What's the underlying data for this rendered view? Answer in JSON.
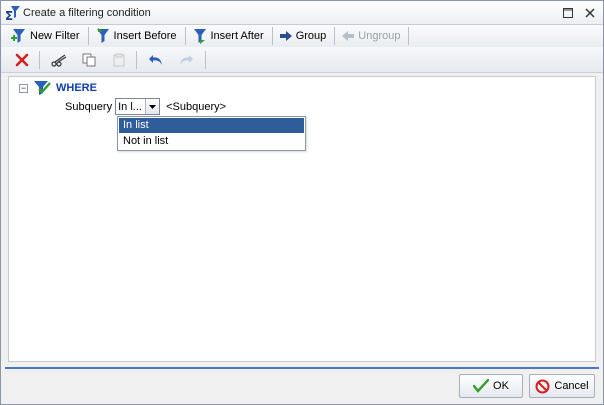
{
  "window": {
    "title": "Create a filtering condition"
  },
  "toolbar": {
    "new_filter": "New Filter",
    "insert_before": "Insert Before",
    "insert_after": "Insert After",
    "group": "Group",
    "ungroup": "Ungroup"
  },
  "edit_toolbar": {
    "icons": [
      "delete-icon",
      "cut-icon",
      "copy-icon",
      "paste-icon",
      "undo-icon",
      "redo-icon"
    ]
  },
  "tree": {
    "root_label": "WHERE",
    "condition": {
      "field_label": "Subquery",
      "operator_value": "In l...",
      "operand": "<Subquery>"
    },
    "operator_options": [
      {
        "label": "In list",
        "selected": true
      },
      {
        "label": "Not in list",
        "selected": false
      }
    ]
  },
  "footer": {
    "ok_label": "OK",
    "cancel_label": "Cancel"
  },
  "colors": {
    "accent": "#4a77c0",
    "selection": "#2f5c9a",
    "where_text": "#1240ab",
    "delete_red": "#d42020"
  }
}
